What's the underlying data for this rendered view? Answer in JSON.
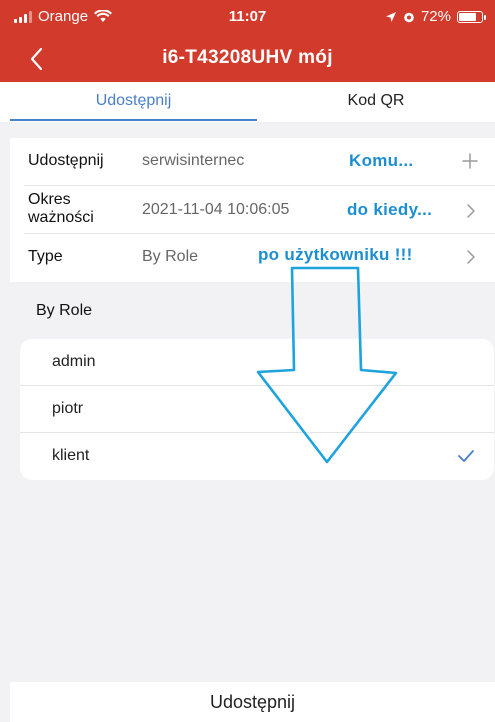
{
  "status_bar": {
    "carrier": "Orange",
    "time": "11:07",
    "battery": "72%",
    "battery_level": 0.72
  },
  "nav": {
    "title": "i6-T43208UHV mój",
    "back_icon": "chevron-left-icon"
  },
  "tabs": [
    {
      "label": "Udostępnij",
      "active": true
    },
    {
      "label": "Kod QR",
      "active": false
    }
  ],
  "form": {
    "share": {
      "label": "Udostępnij",
      "value": "serwisinternec",
      "annotation": "Komu...",
      "icon": "plus-icon"
    },
    "validity": {
      "label_line1": "Okres",
      "label_line2": "ważności",
      "value": "2021-11-04 10:06:05",
      "annotation": "do kiedy...",
      "icon": "chevron-right-icon"
    },
    "type": {
      "label": "Type",
      "value": "By Role",
      "annotation": "po użytkowniku !!!",
      "icon": "chevron-right-icon"
    }
  },
  "role_section": {
    "title": "By Role",
    "items": [
      {
        "label": "admin",
        "selected": false
      },
      {
        "label": "piotr",
        "selected": false
      },
      {
        "label": "klient",
        "selected": true
      }
    ]
  },
  "bottom": {
    "button_label": "Udostępnij"
  },
  "colors": {
    "header": "#d23a2c",
    "accent": "#4a7fc9",
    "annotation": "#1d8fd0"
  }
}
